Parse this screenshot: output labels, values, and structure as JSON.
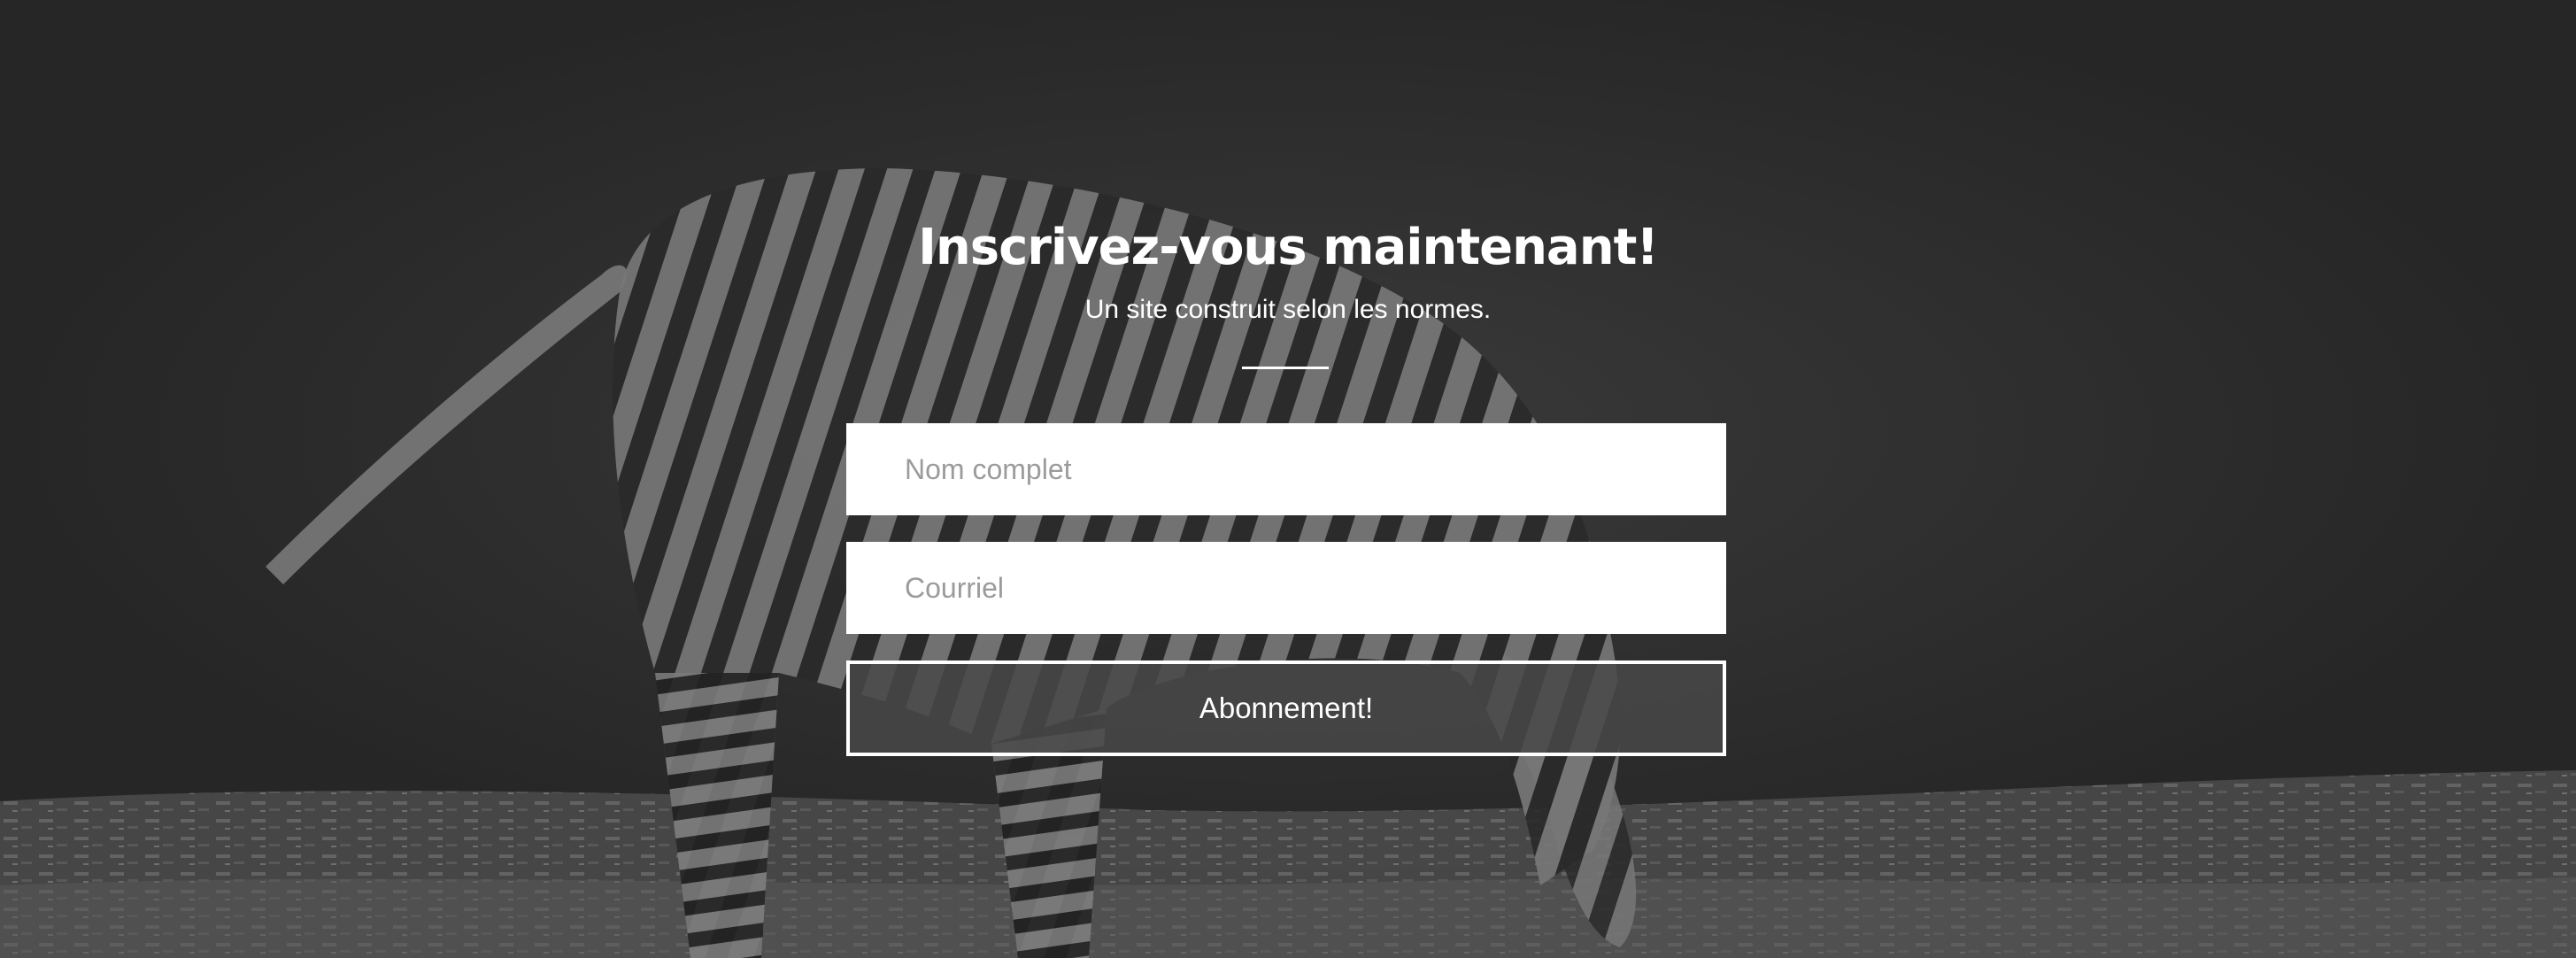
{
  "hero": {
    "title": "Inscrivez-vous maintenant!",
    "subtitle": "Un site construit selon les normes."
  },
  "form": {
    "name_placeholder": "Nom complet",
    "email_placeholder": "Courriel",
    "submit_label": "Abonnement!"
  },
  "colors": {
    "background": "#262626",
    "text": "#ffffff",
    "input_background": "#ffffff",
    "placeholder": "#9b9b9b",
    "button_background": "#484848"
  }
}
